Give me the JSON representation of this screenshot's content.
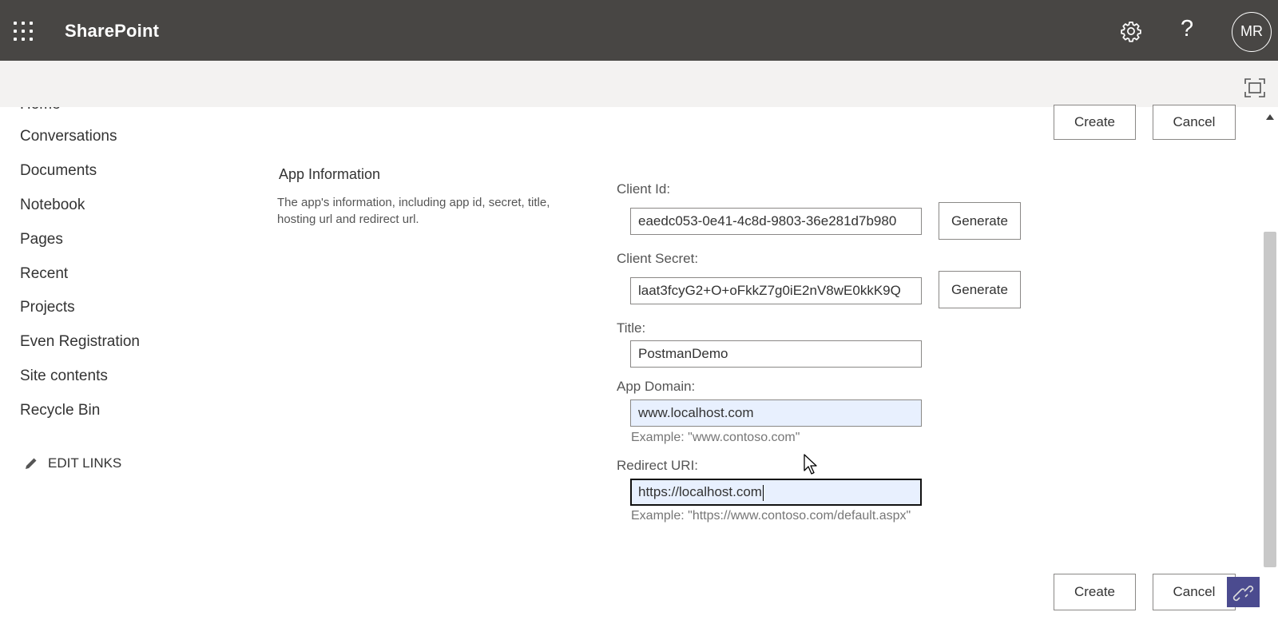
{
  "suitebar": {
    "brand": "SharePoint",
    "help_label": "?",
    "avatar_initials": "MR"
  },
  "nav": {
    "home": "Home",
    "items": [
      "Conversations",
      "Documents",
      "Notebook",
      "Pages",
      "Recent",
      "Projects",
      "Even Registration",
      "Site contents",
      "Recycle Bin"
    ],
    "edit_links": "EDIT LINKS"
  },
  "actions": {
    "create": "Create",
    "cancel": "Cancel"
  },
  "section": {
    "title": "App Information",
    "description": "The app's information, including app id, secret, title, hosting url and redirect url."
  },
  "form": {
    "client_id": {
      "label": "Client Id:",
      "value": "eaedc053-0e41-4c8d-9803-36e281d7b980",
      "button": "Generate"
    },
    "client_secret": {
      "label": "Client Secret:",
      "value": "laat3fcyG2+O+oFkkZ7g0iE2nV8wE0kkK9Q",
      "button": "Generate"
    },
    "title": {
      "label": "Title:",
      "value": "PostmanDemo"
    },
    "app_domain": {
      "label": "App Domain:",
      "value": "www.localhost.com",
      "example": "Example: \"www.contoso.com\""
    },
    "redirect_uri": {
      "label": "Redirect URI:",
      "value": "https://localhost.com",
      "example": "Example: \"https://www.contoso.com/default.aspx\""
    }
  },
  "colors": {
    "suitebar_bg": "#484644",
    "commandbar_bg": "#f3f2f1",
    "autofill_bg": "#e8f0fe"
  }
}
